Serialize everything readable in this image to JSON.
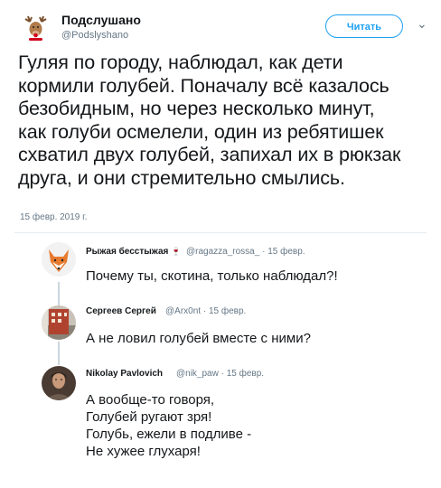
{
  "account": {
    "name": "Подслушано",
    "handle": "@Podslyshano",
    "follow_label": "Читать",
    "menu_glyph": "⌄"
  },
  "tweet": {
    "text": "Гуляя по городу, наблюдал, как дети\nкормили голубей. Поначалу всё казалось\nбезобидным, но через несколько минут,\nкак голуби осмелели, один из ребятишек\nсхватил двух голубей, запихал их в рюкзак\nдруга, и они стремительно смылись.",
    "date": "15 февр. 2019 г."
  },
  "replies": [
    {
      "name": "Рыжая бесстыжая",
      "emoji": "🍷",
      "handle": "@ragazza_rossa_",
      "date": "· 15 февр.",
      "text": "Почему ты, скотина, только наблюдал?!"
    },
    {
      "name": "Сергеев Сергей",
      "handle": "@Arx0nt",
      "date": "· 15 февр.",
      "text": "А не ловил голубей вместе с ними?"
    },
    {
      "name": "Nikolay Pavlovich",
      "handle": "@nik_paw",
      "date": "· 15 февр.",
      "text": "А вообще-то говоря,\nГолубей ругают зря!\nГолубь, ежели в подливе -\nНе хужее глухаря!"
    }
  ]
}
